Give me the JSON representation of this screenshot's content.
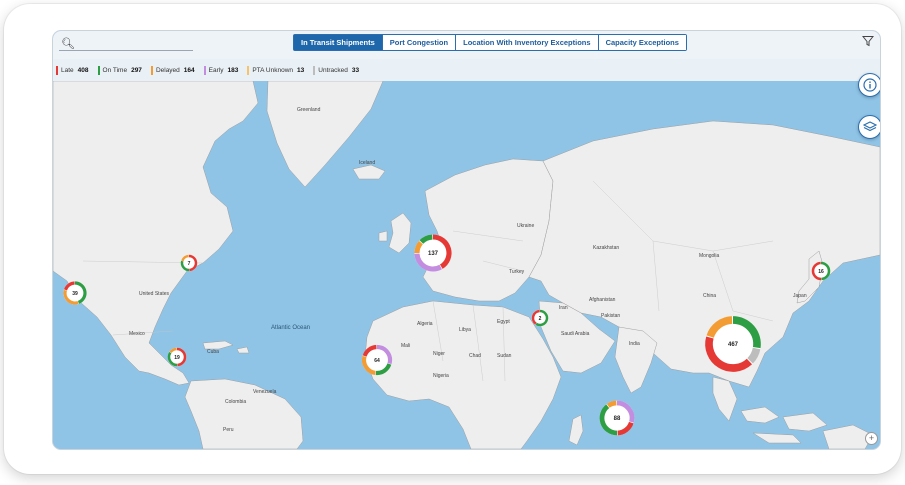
{
  "toolbar": {
    "search_placeholder": "",
    "tabs": [
      {
        "label": "In Transit Shipments",
        "active": true
      },
      {
        "label": "Port Congestion",
        "active": false
      },
      {
        "label": "Location With Inventory Exceptions",
        "active": false
      },
      {
        "label": "Capacity Exceptions",
        "active": false
      }
    ]
  },
  "legend": [
    {
      "label": "Late",
      "count": "408",
      "color": "#e53935"
    },
    {
      "label": "On Time",
      "count": "297",
      "color": "#2e9e44"
    },
    {
      "label": "Delayed",
      "count": "164",
      "color": "#f39c34"
    },
    {
      "label": "Early",
      "count": "183",
      "color": "#c48ee0"
    },
    {
      "label": "PTA Unknown",
      "count": "13",
      "color": "#f7c36a"
    },
    {
      "label": "Untracked",
      "count": "33",
      "color": "#bdbdbd"
    }
  ],
  "map_labels": {
    "greenland": "Greenland",
    "iceland": "Iceland",
    "united_states": "United States",
    "mexico": "Mexico",
    "atlantic": "Atlantic Ocean",
    "algeria": "Algeria",
    "libya": "Libya",
    "egypt": "Egypt",
    "kazakhstan": "Kazakhstan",
    "mongolia": "Mongolia",
    "china": "China",
    "india": "India",
    "iran": "Iran",
    "japan": "Japan",
    "turkey": "Turkey",
    "niger": "Niger",
    "chad": "Chad",
    "sudan": "Sudan",
    "mali": "Mali",
    "nigeria": "Nigeria",
    "afghanistan": "Afghanistan",
    "pakistan": "Pakistan",
    "saudi": "Saudi Arabia",
    "cuba": "Cuba",
    "venezuela": "Venezuela",
    "colombia": "Colombia",
    "peru": "Peru",
    "ukraine": "Ukraine"
  },
  "clusters": [
    {
      "id": "west-us",
      "count": "39"
    },
    {
      "id": "great-lakes",
      "count": "7"
    },
    {
      "id": "central-america",
      "count": "19"
    },
    {
      "id": "europe",
      "count": "137"
    },
    {
      "id": "west-africa",
      "count": "64"
    },
    {
      "id": "gulf",
      "count": "2"
    },
    {
      "id": "east-asia",
      "count": "467"
    },
    {
      "id": "japan",
      "count": "16"
    },
    {
      "id": "indian-ocean",
      "count": "88"
    }
  ],
  "icons": {
    "search": "search-icon",
    "filter": "filter-icon",
    "info": "info-icon",
    "layers": "layers-icon",
    "zoom": "plus-icon"
  }
}
